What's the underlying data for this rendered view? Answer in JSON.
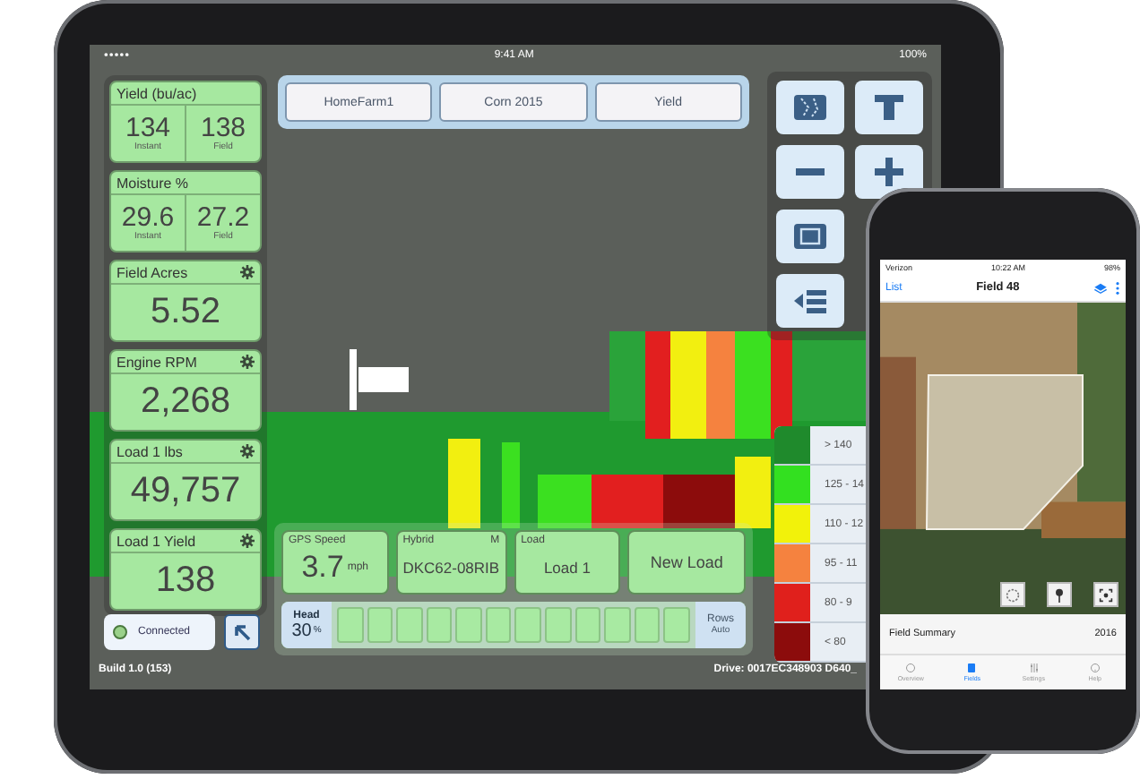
{
  "tablet": {
    "status_bar": {
      "time": "9:41 AM",
      "battery": "100%"
    },
    "metric_cards": [
      {
        "title": "Yield (bu/ac)",
        "kind": "split",
        "settings": false,
        "values": [
          {
            "value": "134",
            "label": "Instant"
          },
          {
            "value": "138",
            "label": "Field"
          }
        ]
      },
      {
        "title": "Moisture %",
        "kind": "split",
        "settings": false,
        "values": [
          {
            "value": "29.6",
            "label": "Instant"
          },
          {
            "value": "27.2",
            "label": "Field"
          }
        ]
      },
      {
        "title": "Field Acres",
        "kind": "single",
        "settings": true,
        "values": [
          {
            "value": "5.52"
          }
        ]
      },
      {
        "title": "Engine RPM",
        "kind": "single",
        "settings": true,
        "values": [
          {
            "value": "2,268"
          }
        ]
      },
      {
        "title": "Load 1 lbs",
        "kind": "single",
        "settings": true,
        "values": [
          {
            "value": "49,757"
          }
        ]
      },
      {
        "title": "Load 1 Yield",
        "kind": "single",
        "settings": true,
        "values": [
          {
            "value": "138"
          }
        ]
      }
    ],
    "connection": {
      "label": "Connected",
      "connected": true
    },
    "top_buttons": [
      "HomeFarm1",
      "Corn 2015",
      "Yield"
    ],
    "bottom_cards": [
      {
        "title": "GPS Speed",
        "value": "3.7",
        "unit": "mph"
      },
      {
        "title": "Hybrid",
        "badge": "M",
        "value": "DKC62-08RIB"
      },
      {
        "title": "Load",
        "value": "Load 1"
      }
    ],
    "new_load_button": "New Load",
    "head": {
      "label": "Head",
      "value": "30",
      "unit": "%"
    },
    "rows": {
      "label": "Rows",
      "auto_label": "Auto"
    },
    "legend": [
      {
        "label": "> 140",
        "color": "#1f8a2c"
      },
      {
        "label": "125 - 14",
        "color": "#33e020"
      },
      {
        "label": "110 - 12",
        "color": "#f2f20a"
      },
      {
        "label": "95 - 11",
        "color": "#f5823f"
      },
      {
        "label": "80 - 9",
        "color": "#e0201c"
      },
      {
        "label": "< 80",
        "color": "#8c0c0c"
      }
    ],
    "footer": {
      "build": "Build 1.0 (153)",
      "drive": "Drive: 0017EC348903 D640_"
    }
  },
  "phone": {
    "status_bar": {
      "carrier": "Verizon",
      "time": "10:22 AM",
      "battery": "98%"
    },
    "nav": {
      "back": "List",
      "title": "Field 48"
    },
    "summary": {
      "title": "Field Summary",
      "year": "2016"
    },
    "tabs": [
      {
        "label": "Overview",
        "selected": false
      },
      {
        "label": "Fields",
        "selected": true
      },
      {
        "label": "Settings",
        "selected": false
      },
      {
        "label": "Help",
        "selected": false
      }
    ]
  }
}
